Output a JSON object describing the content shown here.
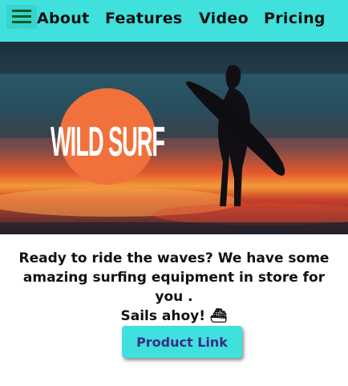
{
  "nav": {
    "menu_icon": "hamburger-icon",
    "links": [
      "About",
      "Features",
      "Video",
      "Pricing"
    ]
  },
  "hero": {
    "logo_text": "WILD SURF"
  },
  "content": {
    "line1": "Ready to ride the waves? We have some",
    "line2": "amazing surfing equipment in store for you .",
    "line3": "Sails ahoy!",
    "ship_emoji": "⛴"
  },
  "cta": {
    "label": "Product Link"
  },
  "colors": {
    "accent": "#40e0dc",
    "button_text": "#3b2a8c",
    "logo_circle": "#f0713c"
  }
}
